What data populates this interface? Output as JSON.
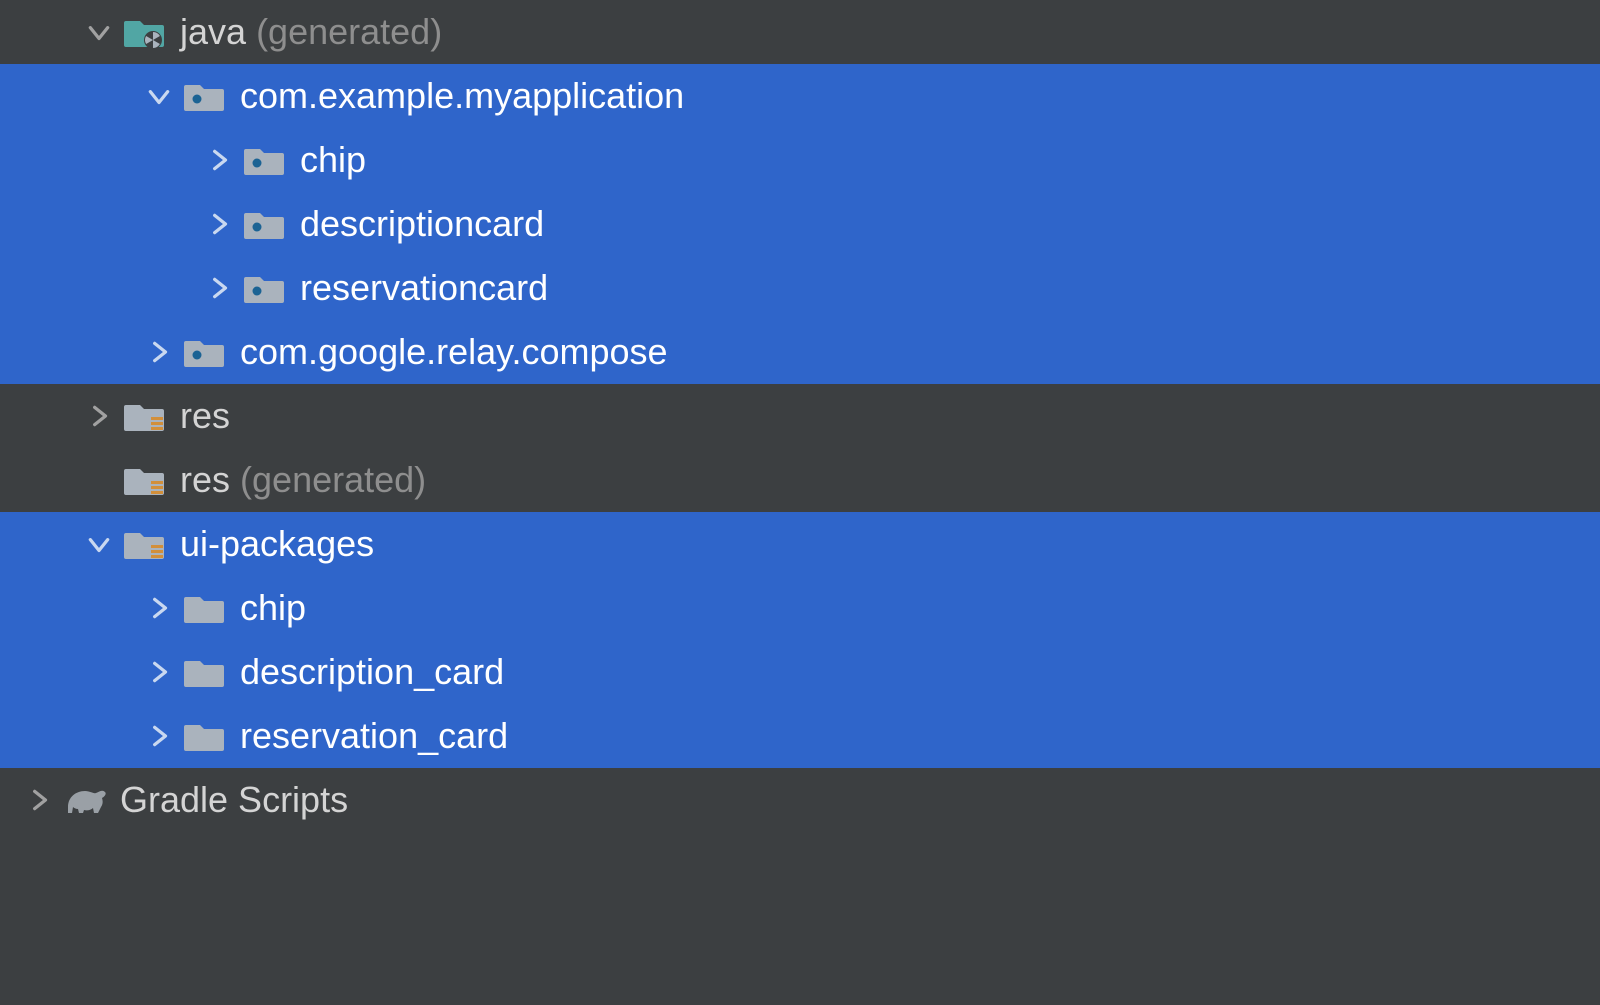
{
  "colors": {
    "bg": "#3c3f41",
    "selection": "#2f65ca",
    "text": "#d4d4d4",
    "dim": "#8e8e8e",
    "arrowDark": "#a1a1a1",
    "arrowSel": "#c9d8f0",
    "folderLight": "#aab3bd",
    "folderTeal": "#51a6a4",
    "folderDot": "#1b6394"
  },
  "rows": {
    "r0": {
      "label": "java",
      "suffix": "(generated)"
    },
    "r1": {
      "label": "com.example.myapplication"
    },
    "r2": {
      "label": "chip"
    },
    "r3": {
      "label": "descriptioncard"
    },
    "r4": {
      "label": "reservationcard"
    },
    "r5": {
      "label": "com.google.relay.compose"
    },
    "r6": {
      "label": "res"
    },
    "r7": {
      "label": "res",
      "suffix": "(generated)"
    },
    "r8": {
      "label": "ui-packages"
    },
    "r9": {
      "label": "chip"
    },
    "r10": {
      "label": "description_card"
    },
    "r11": {
      "label": "reservation_card"
    },
    "r12": {
      "label": "Gradle Scripts"
    }
  }
}
